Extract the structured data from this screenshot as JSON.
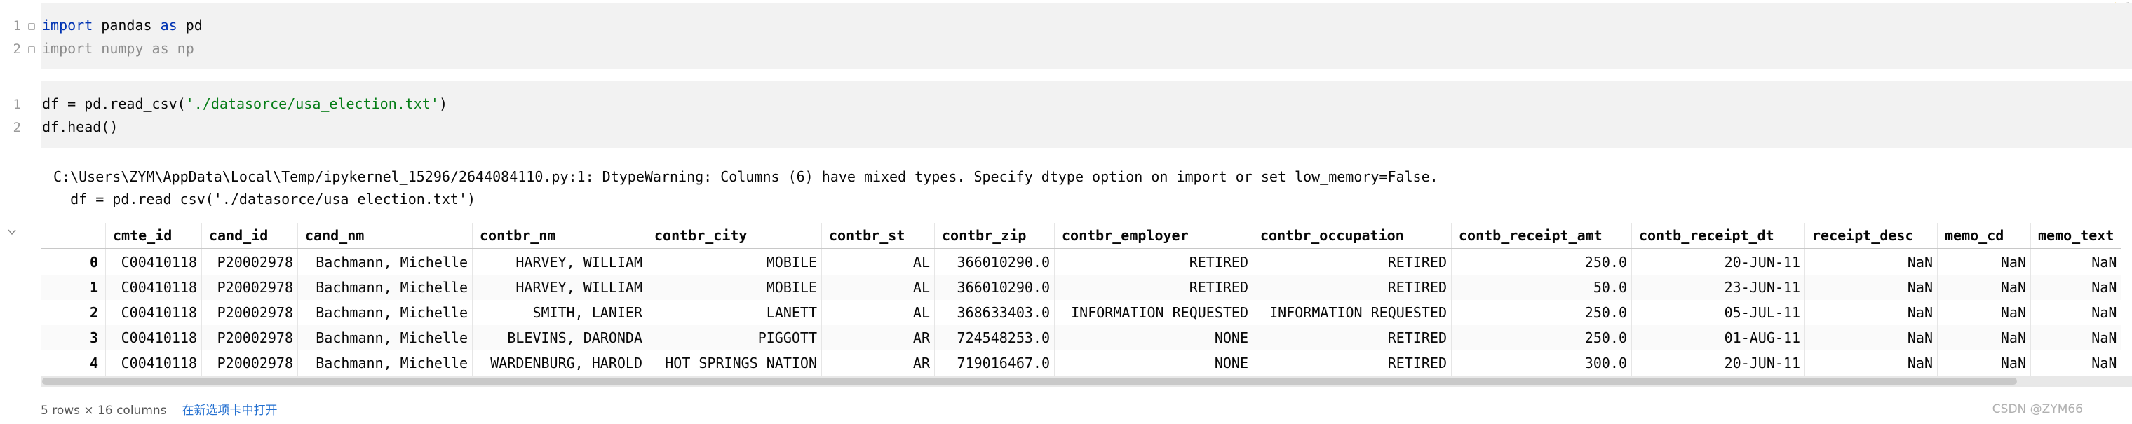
{
  "cell1": {
    "line_numbers": [
      "1",
      "2"
    ],
    "line1": {
      "kw1": "import",
      "mod": " pandas ",
      "kw2": "as",
      "alias": " pd"
    },
    "line2": {
      "kw1": "import",
      "mod": " numpy ",
      "kw2": "as",
      "alias": " np"
    }
  },
  "cell2": {
    "line_numbers": [
      "1",
      "2"
    ],
    "line1": {
      "pre": "df = pd.read_csv(",
      "str": "'./datasorce/usa_election.txt'",
      "post": ")"
    },
    "line2": "df.head()"
  },
  "output": {
    "warning_line1": "C:\\Users\\ZYM\\AppData\\Local\\Temp/ipykernel_15296/2644084110.py:1: DtypeWarning: Columns (6) have mixed types. Specify dtype option on import or set low_memory=False.",
    "warning_line2": "  df = pd.read_csv('./datasorce/usa_election.txt')",
    "warning_badge_count": "1",
    "table": {
      "columns": [
        "",
        "cmte_id",
        "cand_id",
        "cand_nm",
        "contbr_nm",
        "contbr_city",
        "contbr_st",
        "contbr_zip",
        "contbr_employer",
        "contbr_occupation",
        "contb_receipt_amt",
        "contb_receipt_dt",
        "receipt_desc",
        "memo_cd",
        "memo_text"
      ],
      "rows": [
        [
          "0",
          "C00410118",
          "P20002978",
          "Bachmann, Michelle",
          "HARVEY, WILLIAM",
          "MOBILE",
          "AL",
          "366010290.0",
          "RETIRED",
          "RETIRED",
          "250.0",
          "20-JUN-11",
          "NaN",
          "NaN",
          "NaN"
        ],
        [
          "1",
          "C00410118",
          "P20002978",
          "Bachmann, Michelle",
          "HARVEY, WILLIAM",
          "MOBILE",
          "AL",
          "366010290.0",
          "RETIRED",
          "RETIRED",
          "50.0",
          "23-JUN-11",
          "NaN",
          "NaN",
          "NaN"
        ],
        [
          "2",
          "C00410118",
          "P20002978",
          "Bachmann, Michelle",
          "SMITH, LANIER",
          "LANETT",
          "AL",
          "368633403.0",
          "INFORMATION REQUESTED",
          "INFORMATION REQUESTED",
          "250.0",
          "05-JUL-11",
          "NaN",
          "NaN",
          "NaN"
        ],
        [
          "3",
          "C00410118",
          "P20002978",
          "Bachmann, Michelle",
          "BLEVINS, DARONDA",
          "PIGGOTT",
          "AR",
          "724548253.0",
          "NONE",
          "RETIRED",
          "250.0",
          "01-AUG-11",
          "NaN",
          "NaN",
          "NaN"
        ],
        [
          "4",
          "C00410118",
          "P20002978",
          "Bachmann, Michelle",
          "WARDENBURG, HAROLD",
          "HOT SPRINGS NATION",
          "AR",
          "719016467.0",
          "NONE",
          "RETIRED",
          "300.0",
          "20-JUN-11",
          "NaN",
          "NaN",
          "NaN"
        ]
      ]
    },
    "summary": "5 rows × 16 columns",
    "open_in_tab": "在新选项卡中打开"
  },
  "watermark": "CSDN @ZYM66",
  "colors": {
    "keyword": "#0033b3",
    "string": "#067d17",
    "link": "#2470d0",
    "cell_bg": "#f2f2f2"
  },
  "icons": [
    "warning-icon",
    "fold-marker-icon",
    "collapse-output-icon"
  ]
}
